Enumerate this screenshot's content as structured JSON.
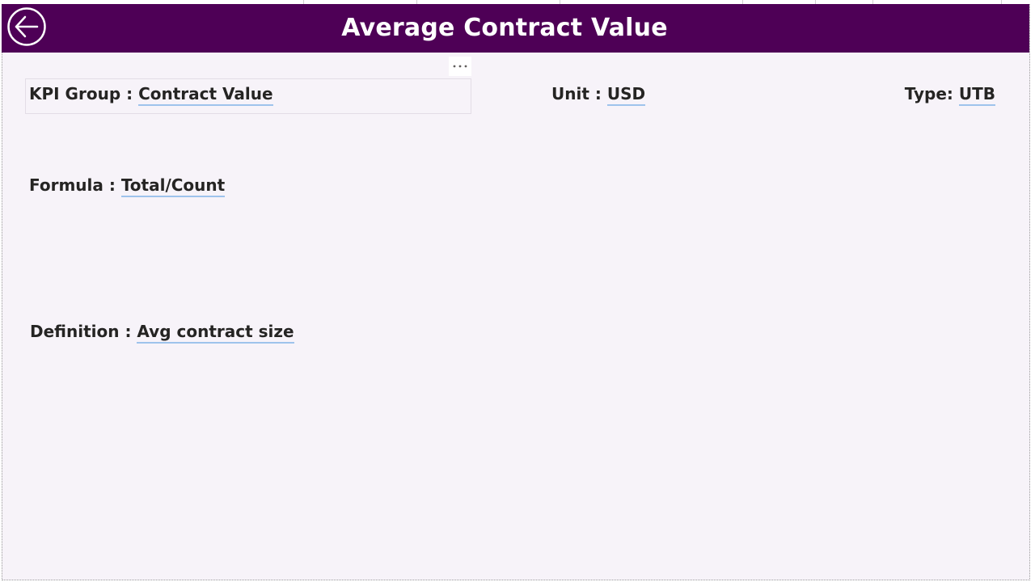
{
  "header": {
    "title": "Average Contract Value",
    "background_color": "#4e0056",
    "text_color": "#ffffff",
    "back_icon": "back-arrow-circle-icon",
    "more_options_icon": "ellipsis-icon"
  },
  "fields": {
    "kpi_group": {
      "label": "KPI Group : ",
      "value": "Contract Value"
    },
    "unit": {
      "label": "Unit : ",
      "value": "USD"
    },
    "type": {
      "label": "Type: ",
      "value": "UTB"
    },
    "formula": {
      "label": "Formula : ",
      "value": "Total/Count"
    },
    "definition": {
      "label": "Definition : ",
      "value": "Avg contract size"
    }
  },
  "colors": {
    "page_background": "#f7f3f9",
    "text": "#252423",
    "value_underline": "#9ec3ec"
  }
}
